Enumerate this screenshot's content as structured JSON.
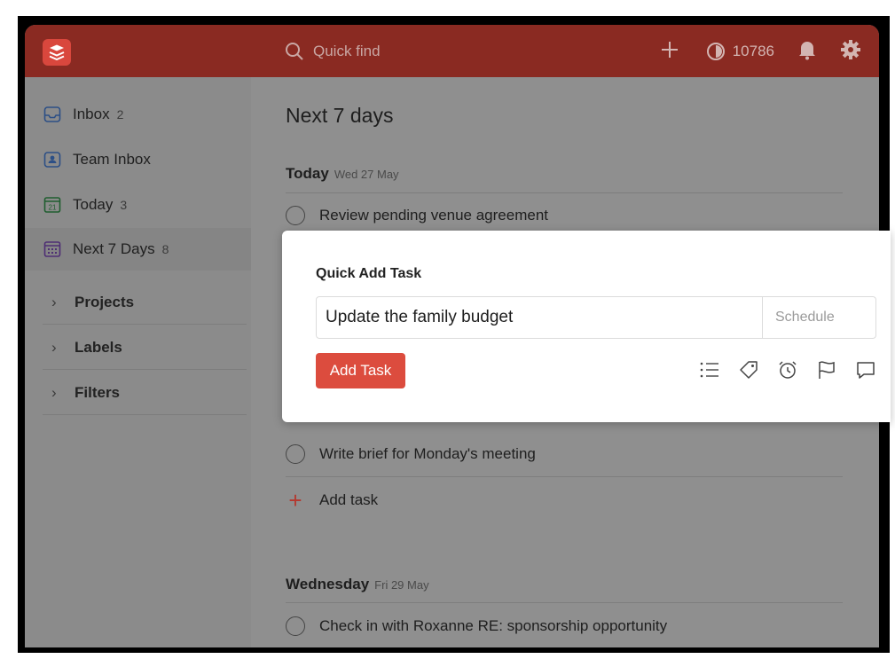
{
  "topbar": {
    "search_placeholder": "Quick find",
    "karma": "10786",
    "brand_color": "#8a2a22"
  },
  "sidebar": {
    "items": [
      {
        "label": "Inbox",
        "count": "2",
        "icon": "inbox-icon"
      },
      {
        "label": "Team Inbox",
        "count": "",
        "icon": "team-inbox-icon"
      },
      {
        "label": "Today",
        "count": "3",
        "icon": "calendar-today-icon"
      },
      {
        "label": "Next 7 Days",
        "count": "8",
        "icon": "calendar-week-icon"
      }
    ],
    "sections": [
      "Projects",
      "Labels",
      "Filters"
    ]
  },
  "main": {
    "title": "Next 7 days",
    "days": [
      {
        "name": "Today",
        "date": "Wed 27 May",
        "tasks": [
          "Review pending venue agreement",
          "Write brief for Monday's meeting"
        ],
        "add_task_label": "Add task"
      },
      {
        "name": "Wednesday",
        "date": "Fri 29 May",
        "tasks": [
          "Check in with Roxanne RE: sponsorship opportunity"
        ]
      }
    ]
  },
  "modal": {
    "title": "Quick Add Task",
    "input_value": "Update the family budget",
    "schedule_placeholder": "Schedule",
    "add_button": "Add Task",
    "accent_color": "#dc4c3e"
  }
}
